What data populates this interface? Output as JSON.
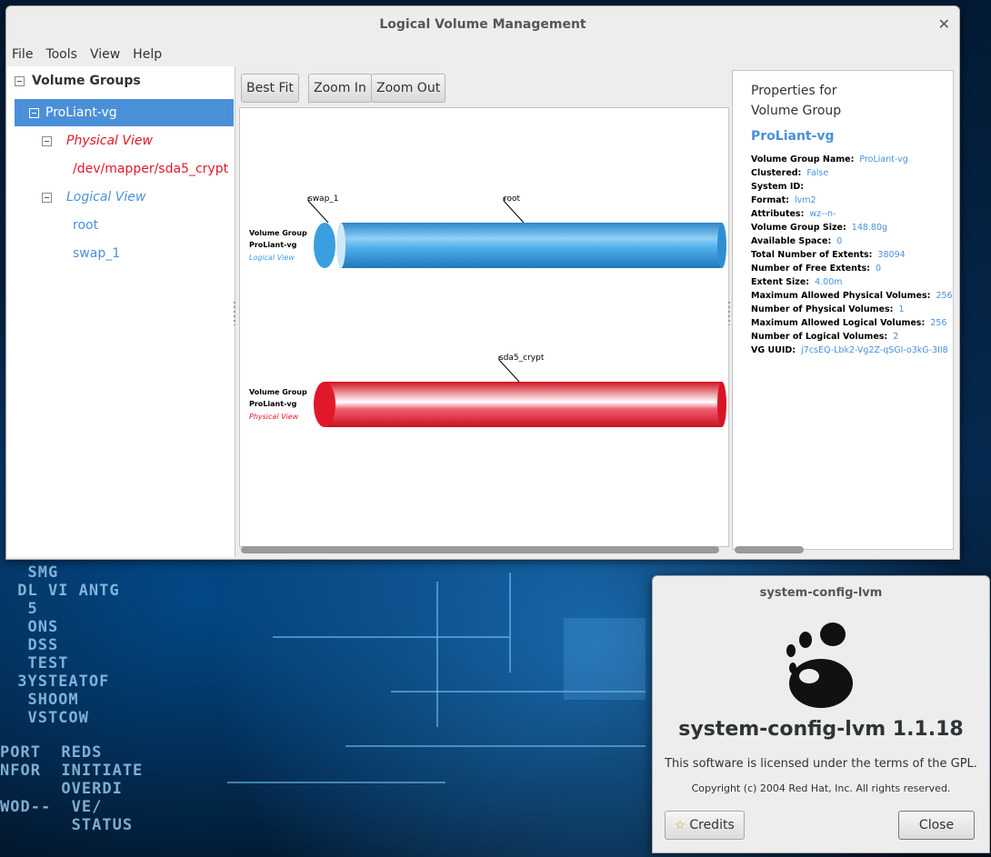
{
  "window": {
    "title": "Logical Volume Management"
  },
  "menu": [
    "File",
    "Tools",
    "View",
    "Help"
  ],
  "tree": {
    "root": "Volume Groups",
    "group": "ProLiant-vg",
    "physical_view": "Physical View",
    "physical_item": "/dev/mapper/sda5_crypt",
    "logical_view": "Logical View",
    "logical_items": [
      "root",
      "swap_1"
    ]
  },
  "toolbar": {
    "best_fit": "Best Fit",
    "zoom_in": "Zoom In",
    "zoom_out": "Zoom Out"
  },
  "diagram": {
    "logical": {
      "line1": "Volume Group",
      "line2": "ProLiant-vg",
      "view": "Logical View",
      "labels": [
        "swap_1",
        "root"
      ]
    },
    "physical": {
      "line1": "Volume Group",
      "line2": "ProLiant-vg",
      "view": "Physical View",
      "labels": [
        "sda5_crypt"
      ]
    },
    "colors": {
      "logical": "#3a9ee0",
      "physical": "#e0182a"
    }
  },
  "properties": {
    "heading1": "Properties for",
    "heading2": "Volume Group",
    "heading3": "ProLiant-vg",
    "rows": [
      {
        "key": "Volume Group Name:",
        "value": "ProLiant-vg"
      },
      {
        "key": "Clustered:",
        "value": "False"
      },
      {
        "key": "System ID:",
        "value": ""
      },
      {
        "key": "Format:",
        "value": "lvm2"
      },
      {
        "key": "Attributes:",
        "value": "wz--n-"
      },
      {
        "key": "Volume Group Size:",
        "value": "148.80g"
      },
      {
        "key": "Available Space:",
        "value": "0"
      },
      {
        "key": "Total Number of Extents:",
        "value": "38094"
      },
      {
        "key": "Number of Free Extents:",
        "value": "0"
      },
      {
        "key": "Extent Size:",
        "value": "4.00m"
      },
      {
        "key": "Maximum Allowed Physical Volumes:",
        "value": "256"
      },
      {
        "key": "Number of Physical Volumes:",
        "value": "1"
      },
      {
        "key": "Maximum Allowed Logical Volumes:",
        "value": "256"
      },
      {
        "key": "Number of Logical Volumes:",
        "value": "2"
      },
      {
        "key": "VG UUID:",
        "value": "j7csEQ-Lbk2-Vg2Z-qSGl-o3kG-3II8"
      }
    ]
  },
  "about": {
    "title": "system-config-lvm",
    "name": "system-config-lvm 1.1.18",
    "license": "This software is licensed under the terms of the GPL.",
    "copyright": "Copyright (c) 2004 Red Hat, Inc. All rights reserved.",
    "credits": "Credits",
    "close": "Close"
  },
  "desktop_text": {
    "left_top": "  SMG\n DL VI ANTG\n  5\n  ONS\n  DSS\n  TEST\n 3YSTEATOF\n  SHOOM\n  VSTCOW",
    "left_bottom": "PORT  REDS\nNFOR  INITIATE\n      OVERDI\nWOD--  VE/\n       STATUS"
  }
}
